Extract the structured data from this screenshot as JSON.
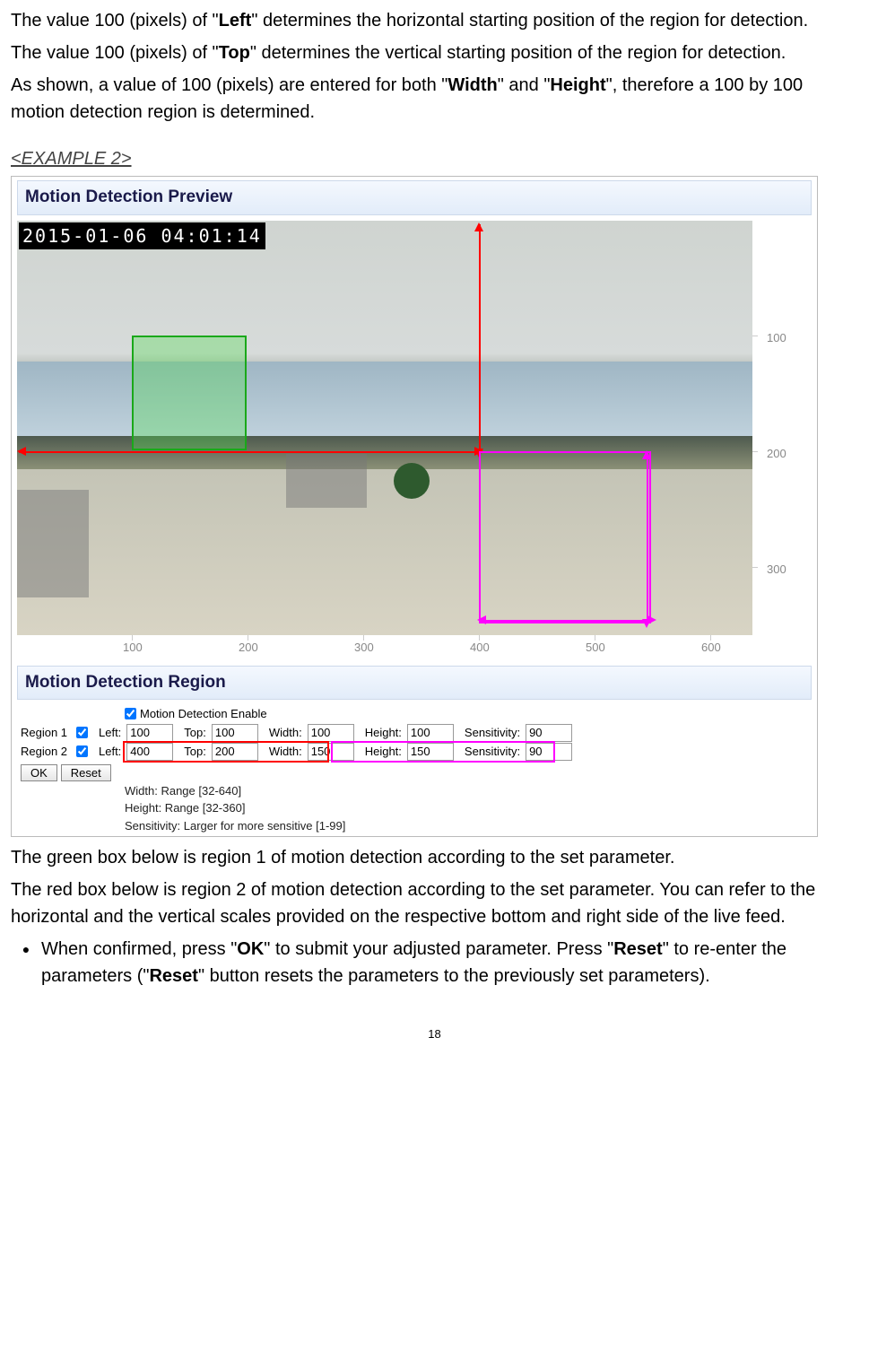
{
  "intro": {
    "p1_a": "The value 100 (pixels) of \"",
    "p1_b": "Left",
    "p1_c": "\" determines the horizontal starting position of the region for detection.",
    "p2_a": "The value 100 (pixels) of \"",
    "p2_b": "Top",
    "p2_c": "\" determines the vertical starting position of the region for detection.",
    "p3_a": "As shown, a value of 100 (pixels) are entered for both \"",
    "p3_b": "Width",
    "p3_c": "\" and \"",
    "p3_d": "Height",
    "p3_e": "\", therefore a 100 by 100 motion detection region is determined."
  },
  "example_heading": "<EXAMPLE 2>",
  "preview": {
    "header": "Motion Detection Preview",
    "timestamp": "2015-01-06  04:01:14",
    "x_ticks": [
      "100",
      "200",
      "300",
      "400",
      "500",
      "600"
    ],
    "y_ticks": [
      "100",
      "200",
      "300"
    ]
  },
  "region_panel": {
    "header": "Motion Detection Region",
    "enable_label": "Motion Detection Enable",
    "labels": {
      "left": "Left:",
      "top": "Top:",
      "width": "Width:",
      "height": "Height:",
      "sensitivity": "Sensitivity:"
    },
    "rows": [
      {
        "name": "Region 1",
        "left": "100",
        "top": "100",
        "width": "100",
        "height": "100",
        "sens": "90"
      },
      {
        "name": "Region 2",
        "left": "400",
        "top": "200",
        "width": "150",
        "height": "150",
        "sens": "90"
      }
    ],
    "buttons": {
      "ok": "OK",
      "reset": "Reset"
    },
    "hints": {
      "w": "Width: Range [32-640]",
      "h": "Height: Range [32-360]",
      "s": "Sensitivity: Larger for more sensitive [1-99]"
    }
  },
  "after": {
    "p1": "The green box below is region 1 of motion detection according to the set parameter.",
    "p2": "The red box below is region 2 of motion detection according to the set parameter. You can refer to the horizontal and the vertical scales provided on the respective bottom and right side of the live feed.",
    "bullet_a": "When confirmed, press \"",
    "bullet_b": "OK",
    "bullet_c": "\" to submit your adjusted parameter. Press \"",
    "bullet_d": "Reset",
    "bullet_e": "\" to re-enter the parameters (\"",
    "bullet_f": "Reset",
    "bullet_g": "\" button resets the parameters to the previously set parameters)."
  },
  "page_number": "18"
}
